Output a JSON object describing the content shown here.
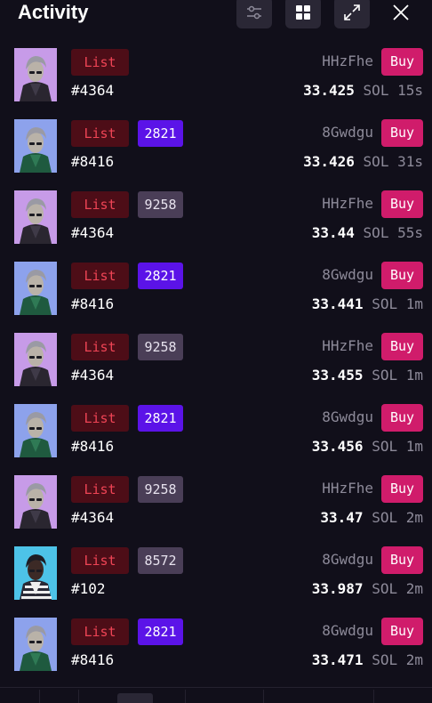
{
  "header": {
    "title": "Activity",
    "buttons": [
      "filter-icon",
      "grid-icon",
      "expand-icon",
      "close-icon"
    ]
  },
  "colors": {
    "background": "#110f1a",
    "list_badge_bg": "#4d0d17",
    "list_badge_text": "#ee4455",
    "rank_purple": "#5b13e8",
    "rank_gray": "#4a3e57",
    "buy_button": "#d01c6b",
    "muted_text": "#8d8a99"
  },
  "activity": [
    {
      "avatar": "purple",
      "type": "List",
      "rank": "",
      "rank_style": "",
      "token": "#4364",
      "seller": "HHzFhe",
      "buy": "Buy",
      "price": "33.425",
      "unit": "SOL",
      "age": "15s"
    },
    {
      "avatar": "blue",
      "type": "List",
      "rank": "2821",
      "rank_style": "purple",
      "token": "#8416",
      "seller": "8Gwdgu",
      "buy": "Buy",
      "price": "33.426",
      "unit": "SOL",
      "age": "31s"
    },
    {
      "avatar": "purple",
      "type": "List",
      "rank": "9258",
      "rank_style": "gray",
      "token": "#4364",
      "seller": "HHzFhe",
      "buy": "Buy",
      "price": "33.44",
      "unit": "SOL",
      "age": "55s"
    },
    {
      "avatar": "blue",
      "type": "List",
      "rank": "2821",
      "rank_style": "purple",
      "token": "#8416",
      "seller": "8Gwdgu",
      "buy": "Buy",
      "price": "33.441",
      "unit": "SOL",
      "age": "1m"
    },
    {
      "avatar": "purple",
      "type": "List",
      "rank": "9258",
      "rank_style": "gray",
      "token": "#4364",
      "seller": "HHzFhe",
      "buy": "Buy",
      "price": "33.455",
      "unit": "SOL",
      "age": "1m"
    },
    {
      "avatar": "blue",
      "type": "List",
      "rank": "2821",
      "rank_style": "purple",
      "token": "#8416",
      "seller": "8Gwdgu",
      "buy": "Buy",
      "price": "33.456",
      "unit": "SOL",
      "age": "1m"
    },
    {
      "avatar": "purple",
      "type": "List",
      "rank": "9258",
      "rank_style": "gray",
      "token": "#4364",
      "seller": "HHzFhe",
      "buy": "Buy",
      "price": "33.47",
      "unit": "SOL",
      "age": "2m"
    },
    {
      "avatar": "cyan",
      "type": "List",
      "rank": "8572",
      "rank_style": "gray",
      "token": "#102",
      "seller": "8Gwdgu",
      "buy": "Buy",
      "price": "33.987",
      "unit": "SOL",
      "age": "2m"
    },
    {
      "avatar": "blue",
      "type": "List",
      "rank": "2821",
      "rank_style": "purple",
      "token": "#8416",
      "seller": "8Gwdgu",
      "buy": "Buy",
      "price": "33.471",
      "unit": "SOL",
      "age": "2m"
    }
  ]
}
